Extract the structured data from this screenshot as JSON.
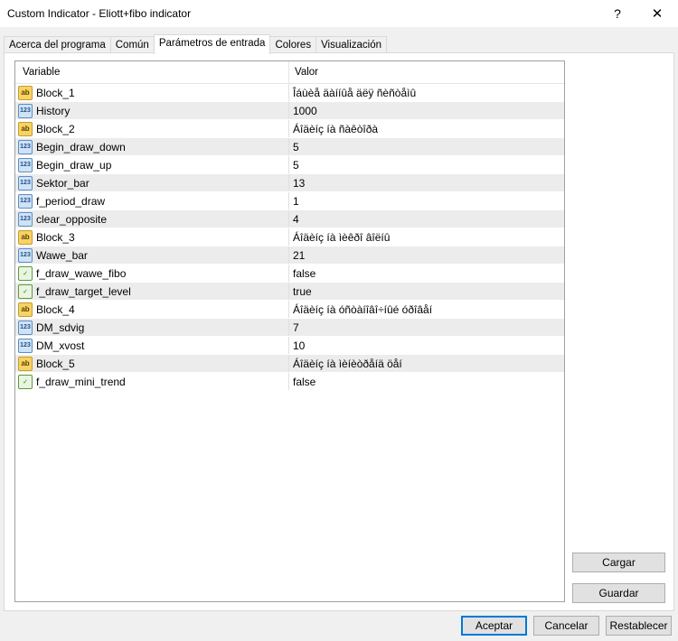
{
  "window": {
    "title": "Custom Indicator - Eliott+fibo indicator",
    "help_label": "?",
    "close_label": "✕"
  },
  "tabs": [
    {
      "label": "Acerca del programa",
      "active": false
    },
    {
      "label": "Común",
      "active": false
    },
    {
      "label": "Parámetros de entrada",
      "active": true
    },
    {
      "label": "Colores",
      "active": false
    },
    {
      "label": "Visualización",
      "active": false
    }
  ],
  "grid": {
    "headers": {
      "variable": "Variable",
      "value": "Valor"
    },
    "rows": [
      {
        "type": "string",
        "icon_label": "ab",
        "name": "Block_1",
        "value": "Îáùèå äàííûå äëÿ ñèñòåìû"
      },
      {
        "type": "int",
        "icon_label": "123",
        "name": "History",
        "value": "1000"
      },
      {
        "type": "string",
        "icon_label": "ab",
        "name": "Block_2",
        "value": "Áîäèíç íà ñàêòîðà"
      },
      {
        "type": "int",
        "icon_label": "123",
        "name": "Begin_draw_down",
        "value": "5"
      },
      {
        "type": "int",
        "icon_label": "123",
        "name": "Begin_draw_up",
        "value": "5"
      },
      {
        "type": "int",
        "icon_label": "123",
        "name": "Sektor_bar",
        "value": "13"
      },
      {
        "type": "int",
        "icon_label": "123",
        "name": "f_period_draw",
        "value": "1"
      },
      {
        "type": "int",
        "icon_label": "123",
        "name": "clear_opposite",
        "value": "4"
      },
      {
        "type": "string",
        "icon_label": "ab",
        "name": "Block_3",
        "value": "Áîäèíç íà ìèêðî âîëíû"
      },
      {
        "type": "int",
        "icon_label": "123",
        "name": "Wawe_bar",
        "value": "21"
      },
      {
        "type": "bool",
        "icon_label": "✓",
        "name": "f_draw_wawe_fibo",
        "value": "false"
      },
      {
        "type": "bool",
        "icon_label": "✓",
        "name": "f_draw_target_level",
        "value": "true"
      },
      {
        "type": "string",
        "icon_label": "ab",
        "name": "Block_4",
        "value": "Áîäèíç íà óñòàíîâî÷íûé óðîâåí"
      },
      {
        "type": "int",
        "icon_label": "123",
        "name": "DM_sdvig",
        "value": "7"
      },
      {
        "type": "int",
        "icon_label": "123",
        "name": "DM_xvost",
        "value": "10"
      },
      {
        "type": "string",
        "icon_label": "ab",
        "name": "Block_5",
        "value": "Áîäèíç íà ìèíèòðåíä öåí"
      },
      {
        "type": "bool",
        "icon_label": "✓",
        "name": "f_draw_mini_trend",
        "value": "false"
      }
    ]
  },
  "side_buttons": {
    "load": "Cargar",
    "save": "Guardar"
  },
  "footer_buttons": {
    "accept": "Aceptar",
    "cancel": "Cancelar",
    "reset": "Restablecer"
  }
}
